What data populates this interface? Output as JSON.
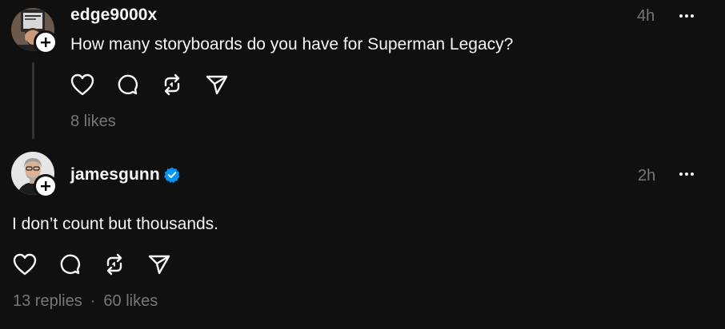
{
  "posts": [
    {
      "username": "edge9000x",
      "verified": false,
      "timestamp": "4h",
      "text": "How many storyboards do you have for Superman Legacy?",
      "likes": "8 likes"
    },
    {
      "username": "jamesgunn",
      "verified": true,
      "timestamp": "2h",
      "text": "I don’t count but thousands.",
      "replies": "13 replies",
      "separator": "·",
      "likes": "60 likes"
    }
  ],
  "icons": {
    "like": "heart-icon",
    "reply": "speech-bubble-icon",
    "repost": "repost-icon",
    "share": "paper-plane-icon",
    "more": "ellipsis-icon",
    "follow": "plus-icon",
    "verified": "verified-check-icon"
  },
  "colors": {
    "background": "#101010",
    "primary_text": "#f3f5f7",
    "secondary_text": "#777777",
    "verified_blue": "#0095f6",
    "thread_line": "#333333"
  }
}
